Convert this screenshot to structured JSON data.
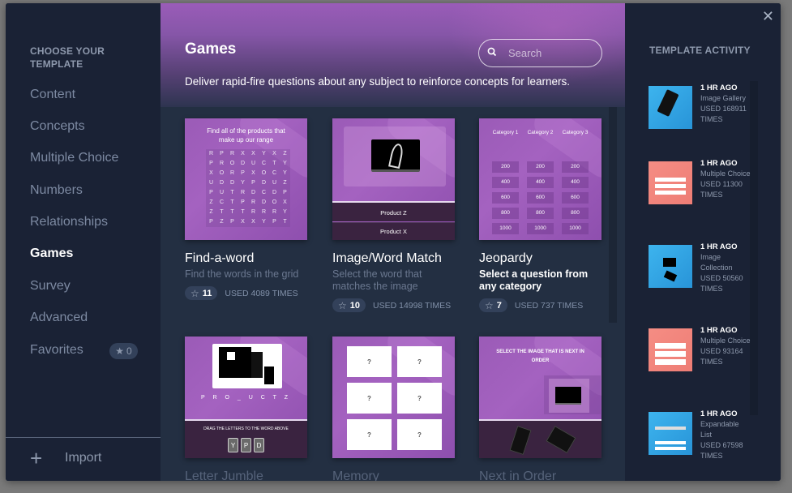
{
  "sidebar": {
    "title": "CHOOSE YOUR TEMPLATE",
    "items": [
      {
        "label": "Content",
        "active": false
      },
      {
        "label": "Concepts",
        "active": false
      },
      {
        "label": "Multiple Choice",
        "active": false
      },
      {
        "label": "Numbers",
        "active": false
      },
      {
        "label": "Relationships",
        "active": false
      },
      {
        "label": "Games",
        "active": true
      },
      {
        "label": "Survey",
        "active": false
      },
      {
        "label": "Advanced",
        "active": false
      },
      {
        "label": "Favorites",
        "active": false
      }
    ],
    "favorites_count": "0",
    "import_label": "Import"
  },
  "header": {
    "title": "Games",
    "description": "Deliver rapid-fire questions about any subject to reinforce concepts for learners.",
    "search_placeholder": "Search"
  },
  "cards": [
    {
      "title": "Find-a-word",
      "description": "Find the words in the grid",
      "stars": "11",
      "used": "USED 4089 TIMES",
      "preview": {
        "heading": "Find all of the products that make up our range",
        "grid": [
          "R",
          "P",
          "R",
          "X",
          "X",
          "Y",
          "X",
          "Z",
          "P",
          "R",
          "O",
          "D",
          "U",
          "C",
          "T",
          "Y",
          "X",
          "O",
          "R",
          "P",
          "X",
          "O",
          "C",
          "Y",
          "U",
          "D",
          "D",
          "Y",
          "P",
          "D",
          "U",
          "Z",
          "P",
          "U",
          "T",
          "R",
          "D",
          "C",
          "D",
          "P",
          "Z",
          "C",
          "T",
          "P",
          "R",
          "D",
          "O",
          "X",
          "Z",
          "T",
          "T",
          "T",
          "R",
          "R",
          "R",
          "Y",
          "P",
          "Z",
          "P",
          "X",
          "X",
          "Y",
          "P",
          "T"
        ]
      }
    },
    {
      "title": "Image/Word Match",
      "description": "Select the word that matches the image",
      "stars": "10",
      "used": "USED 14998 TIMES",
      "preview": {
        "options": [
          "Product Z",
          "Product X"
        ]
      }
    },
    {
      "title": "Jeopardy",
      "description": "Select a question from any category",
      "stars": "7",
      "used": "USED 737 TIMES",
      "preview": {
        "categories": [
          "Category 1",
          "Category 2",
          "Category 3"
        ],
        "values": [
          "200",
          "400",
          "600",
          "800",
          "1000"
        ]
      }
    },
    {
      "title": "Letter Jumble",
      "preview": {
        "word": "P R O _ U C T Z",
        "instruction": "DRAG THE LETTERS TO THE WORD ABOVE",
        "tiles": [
          "Y",
          "P",
          "D"
        ]
      }
    },
    {
      "title": "Memory",
      "preview": {
        "cards": [
          "?",
          "?",
          "?",
          "?",
          "?",
          "?"
        ]
      }
    },
    {
      "title": "Next in Order",
      "preview": {
        "heading": "SELECT THE IMAGE THAT IS NEXT IN ORDER"
      }
    }
  ],
  "activity": {
    "title": "TEMPLATE ACTIVITY",
    "close_icon": "close-icon",
    "items": [
      {
        "time": "1 HR AGO",
        "name": "Image Gallery",
        "used": "USED 168911 TIMES",
        "color": "#3db4ee"
      },
      {
        "time": "1 HR AGO",
        "name": "Multiple Choice",
        "used": "USED 11300 TIMES",
        "color": "#f58d84"
      },
      {
        "time": "1 HR AGO",
        "name": "Image Collection",
        "used": "USED 50560 TIMES",
        "color": "#3db4ee"
      },
      {
        "time": "1 HR AGO",
        "name": "Multiple Choice",
        "used": "USED 93164 TIMES",
        "color": "#f58d84"
      },
      {
        "time": "1 HR AGO",
        "name": "Expandable List",
        "used": "USED 67598 TIMES",
        "color": "#3db4ee"
      }
    ]
  }
}
